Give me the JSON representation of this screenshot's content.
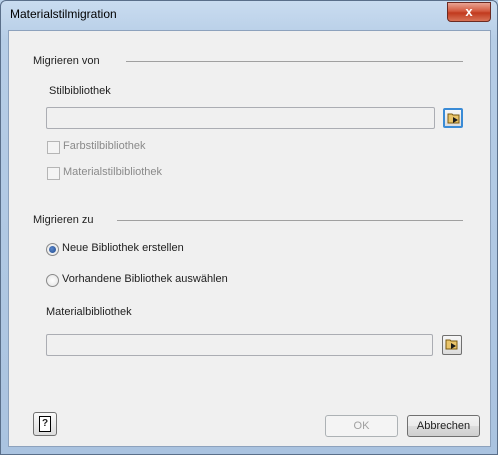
{
  "window": {
    "title": "Materialstilmigration",
    "close_label": "x"
  },
  "from_section": {
    "heading": "Migrieren von",
    "library_label": "Stilbibliothek",
    "library_value": "",
    "options": [
      {
        "label": "Farbstilbibliothek",
        "checked": false,
        "enabled": false
      },
      {
        "label": "Materialstilbibliothek",
        "checked": false,
        "enabled": false
      }
    ]
  },
  "to_section": {
    "heading": "Migrieren zu",
    "radios": [
      {
        "label": "Neue Bibliothek erstellen",
        "selected": true
      },
      {
        "label": "Vorhandene Bibliothek auswählen",
        "selected": false
      }
    ],
    "material_label": "Materialbibliothek",
    "material_value": ""
  },
  "footer": {
    "help_label": "?",
    "ok_label": "OK",
    "cancel_label": "Abbrechen"
  }
}
